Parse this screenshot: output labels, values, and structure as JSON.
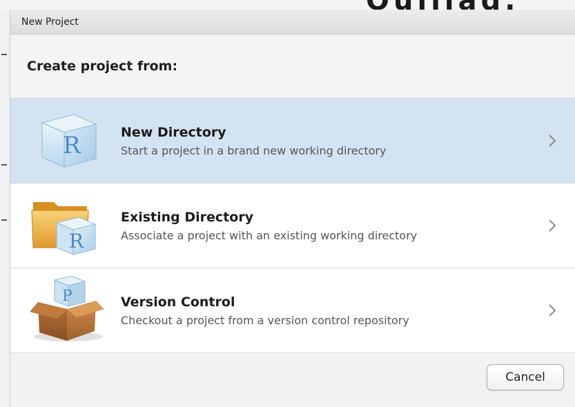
{
  "dialog": {
    "title": "New Project",
    "heading": "Create project from:"
  },
  "options": [
    {
      "title": "New Directory",
      "description": "Start a project in a brand new working directory",
      "icon": "r-cube-icon",
      "selected": true
    },
    {
      "title": "Existing Directory",
      "description": "Associate a project with an existing working directory",
      "icon": "folder-r-icon",
      "selected": false
    },
    {
      "title": "Version Control",
      "description": "Checkout a project from a version control repository",
      "icon": "box-p-icon",
      "selected": false
    }
  ],
  "footer": {
    "cancel_label": "Cancel"
  },
  "colors": {
    "selected_row": "#d3e3f2",
    "dialog_bg": "#f4f4f4"
  }
}
